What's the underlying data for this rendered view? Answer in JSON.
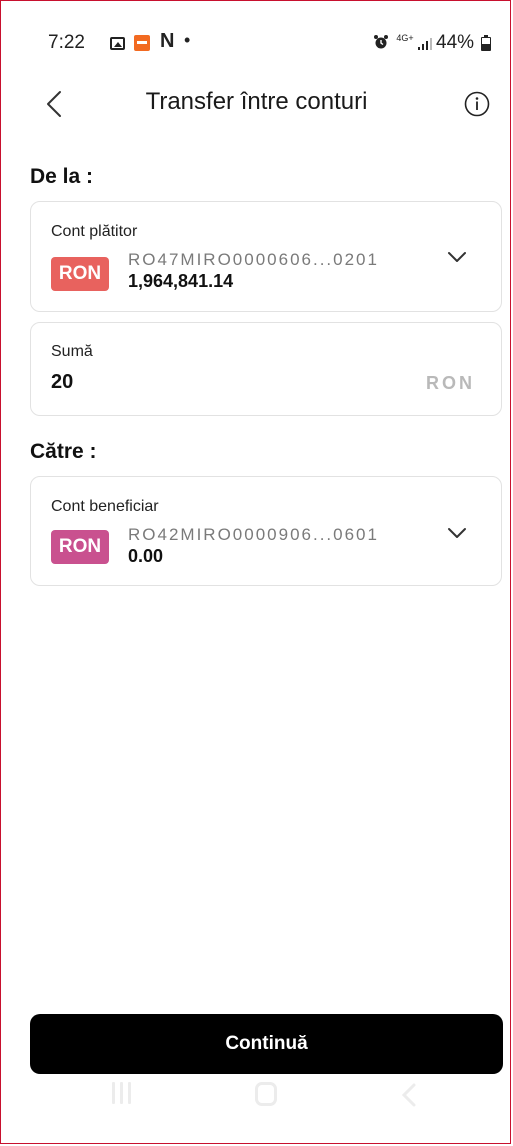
{
  "status_bar": {
    "time": "7:22",
    "notification_letter": "N",
    "dot": "•",
    "network": "4G+",
    "battery": "44%"
  },
  "header": {
    "title": "Transfer între conturi",
    "back_icon": "chevron-left-icon",
    "info_icon": "info-icon"
  },
  "from_section": {
    "title": "De la :",
    "account": {
      "label": "Cont plătitor",
      "currency": "RON",
      "iban": "RO47MIRO0000606...0201",
      "balance": "1,964,841.14",
      "badge_color": "#e8625e"
    },
    "amount": {
      "label": "Sumă",
      "value": "20",
      "currency": "RON"
    }
  },
  "to_section": {
    "title": "Către :",
    "account": {
      "label": "Cont beneficiar",
      "currency": "RON",
      "iban": "RO42MIRO0000906...0601",
      "balance": "0.00",
      "badge_color": "#c9518f"
    }
  },
  "actions": {
    "continue_label": "Continuă"
  },
  "colors": {
    "primary_button": "#000000",
    "border": "#e2e2e2"
  }
}
